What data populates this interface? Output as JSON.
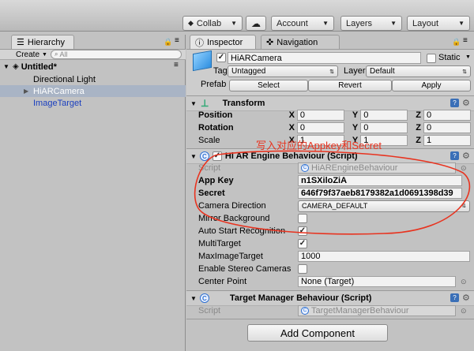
{
  "toolbar": {
    "collab": "Collab",
    "account": "Account",
    "layers": "Layers",
    "layout": "Layout"
  },
  "hierarchy": {
    "tab": "Hierarchy",
    "create": "Create",
    "search_placeholder": "All",
    "scene": "Untitled*",
    "items": [
      "Directional Light",
      "HiARCamera",
      "ImageTarget"
    ]
  },
  "inspector": {
    "tabs": [
      "Inspector",
      "Navigation"
    ],
    "object_name": "HiARCamera",
    "static_label": "Static",
    "tag_label": "Tag",
    "tag_value": "Untagged",
    "layer_label": "Layer",
    "layer_value": "Default",
    "prefab_label": "Prefab",
    "prefab_buttons": [
      "Select",
      "Revert",
      "Apply"
    ]
  },
  "transform": {
    "title": "Transform",
    "rows": [
      {
        "label": "Position",
        "x": "0",
        "y": "0",
        "z": "0"
      },
      {
        "label": "Rotation",
        "x": "0",
        "y": "0",
        "z": "0"
      },
      {
        "label": "Scale",
        "x": "1",
        "y": "1",
        "z": "1"
      }
    ]
  },
  "hiar": {
    "title": "Hi AR Engine Behaviour (Script)",
    "script_label": "Script",
    "script_value": "HiAREngineBehaviour",
    "appkey_label": "App Key",
    "appkey_value": "n1SXiloZiA",
    "secret_label": "Secret",
    "secret_value": "646f79f37aeb8179382a1d0691398d39",
    "camera_dir_label": "Camera Direction",
    "camera_dir_value": "CAMERA_DEFAULT",
    "mirror_label": "Mirror Background",
    "mirror_checked": false,
    "autostart_label": "Auto Start Recognition",
    "autostart_checked": true,
    "multitarget_label": "MultiTarget",
    "multitarget_checked": true,
    "maximage_label": "MaxImageTarget",
    "maximage_value": "1000",
    "stereo_label": "Enable Stereo Cameras",
    "stereo_checked": false,
    "center_label": "Center Point",
    "center_value": "None (Target)"
  },
  "target_manager": {
    "title": "Target Manager Behaviour (Script)",
    "script_label": "Script",
    "script_value": "TargetManagerBehaviour"
  },
  "add_component": "Add Component",
  "annotation": {
    "text": "写入对应的Appkey和Secret",
    "color": "#e8331f"
  }
}
